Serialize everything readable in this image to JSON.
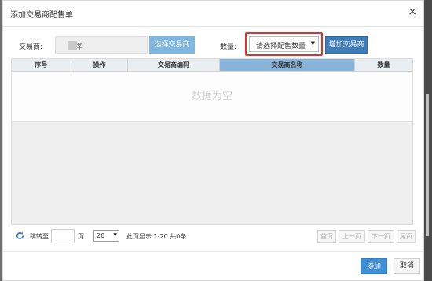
{
  "dialog": {
    "title": "添加交易商配售单",
    "close_glyph": "×"
  },
  "toolbar": {
    "trader_label": "交易商:",
    "trader_value": "华",
    "select_trader_button": "选择交易商",
    "quantity_label": "数量:",
    "quantity_select_value": "请选择配售数量",
    "quantity_arrow": "▼",
    "add_trader_button": "增加交易商"
  },
  "grid": {
    "columns": [
      "序号",
      "操作",
      "交易商编码",
      "交易商名称",
      "数量"
    ],
    "empty_text": "数据为空"
  },
  "pager": {
    "jump_label": "跳转至",
    "page_unit": "页",
    "page_size": "20",
    "size_arrow": "▼",
    "info": "此页显示 1-20 共0条",
    "first": "首页",
    "prev": "上一页",
    "next": "下一页",
    "last": "尾页"
  },
  "footer": {
    "add_button": "添加",
    "cancel_button": "取消"
  },
  "colors": {
    "accent_blue": "#3d8fd8",
    "select_trader_btn": "#7fb7e1",
    "highlight_outline": "#e03030",
    "active_header": "#89b4d9"
  }
}
